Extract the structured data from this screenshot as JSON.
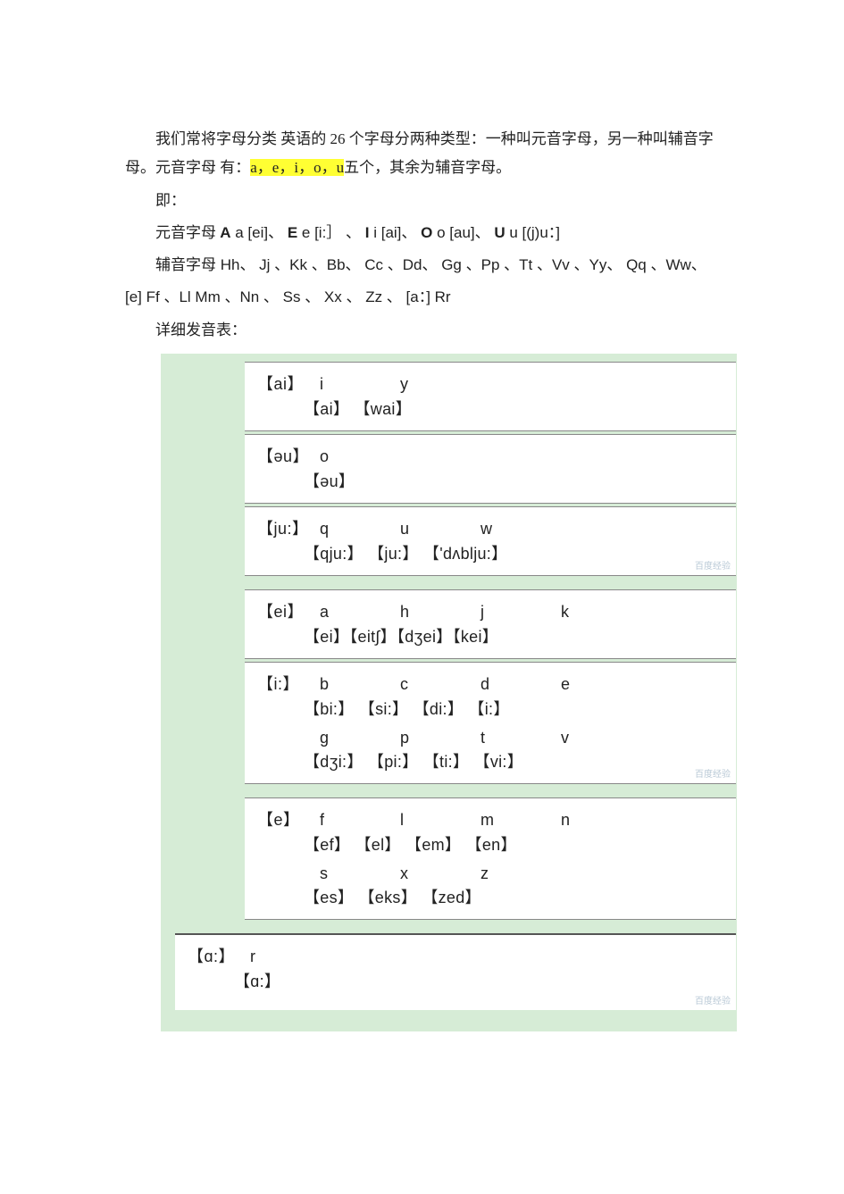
{
  "intro": {
    "p1a": "我们常将字母分类 英语的 26 个字母分两种类型：一种叫元音字母，另一种叫辅音字母。元音字母 有：",
    "p1_hl": "a，e，i，o，u",
    "p1b": "五个，其余为辅音字母。",
    "p2": "即：",
    "p3_prefix": "元音字母   ",
    "p3_items": [
      {
        "b": "A",
        "rest": " a [ei]、   "
      },
      {
        "b": "E",
        "rest": " e [i:］ 、  "
      },
      {
        "b": "I",
        "rest": " i [ai]、 "
      },
      {
        "b": "O",
        "rest": " o [au]、 "
      },
      {
        "b": "U",
        "rest": " u [(j)u：]"
      }
    ],
    "p4": "辅音字母 Hh、  Jj 、Kk 、Bb、  Cc  、Dd、  Gg  、Pp  、Tt 、Vv  、Yy、  Qq  、Ww、",
    "p5": "[e]  Ff  、Ll Mm  、Nn 、 Ss 、 Xx 、 Zz 、 [a：] Rr",
    "p6": "详细发音表："
  },
  "sections": [
    {
      "cells": [
        {
          "r1": {
            "head": "【ai】",
            "cols": [
              "i",
              "y",
              "",
              ""
            ]
          },
          "r2": "【ai】 【wai】"
        },
        {
          "r1": {
            "head": "【əu】",
            "cols": [
              "o",
              "",
              "",
              ""
            ]
          },
          "r2": "【əu】"
        },
        {
          "r1": {
            "head": "【ju:】",
            "cols": [
              "q",
              "u",
              "w",
              ""
            ]
          },
          "r2": "【qju:】 【ju:】 【'dʌblju:】",
          "wm": "百度经验"
        }
      ]
    },
    {
      "cells": [
        {
          "r1": {
            "head": "【ei】",
            "cols": [
              "a",
              "h",
              "j",
              "k"
            ]
          },
          "r2": "【ei】【eit∫】【dʒei】【kei】"
        },
        {
          "r1": {
            "head": "【i:】",
            "cols": [
              "b",
              "c",
              "d",
              "e"
            ]
          },
          "r2": "【bi:】  【si:】   【di:】    【i:】",
          "extra_r1": {
            "head": "",
            "cols": [
              "g",
              "p",
              "t",
              "v"
            ]
          },
          "extra_r2": "【dʒi:】 【pi:】  【ti:】  【vi:】",
          "wm": "百度经验"
        }
      ]
    },
    {
      "cells": [
        {
          "r1": {
            "head": "【e】",
            "cols": [
              "f",
              "l",
              "m",
              "n"
            ]
          },
          "r2": "【ef】 【el】  【em】  【en】",
          "extra_r1": {
            "head": "",
            "cols": [
              "s",
              "x",
              "z",
              ""
            ]
          },
          "extra_r2": "【es】 【eks】 【zed】"
        }
      ]
    },
    {
      "last": true,
      "cells": [
        {
          "detached": true,
          "r1": {
            "head": "【ɑ:】",
            "cols": [
              "r",
              "",
              "",
              ""
            ]
          },
          "r2": "【ɑ:】",
          "wm": "百度经验"
        }
      ]
    }
  ]
}
